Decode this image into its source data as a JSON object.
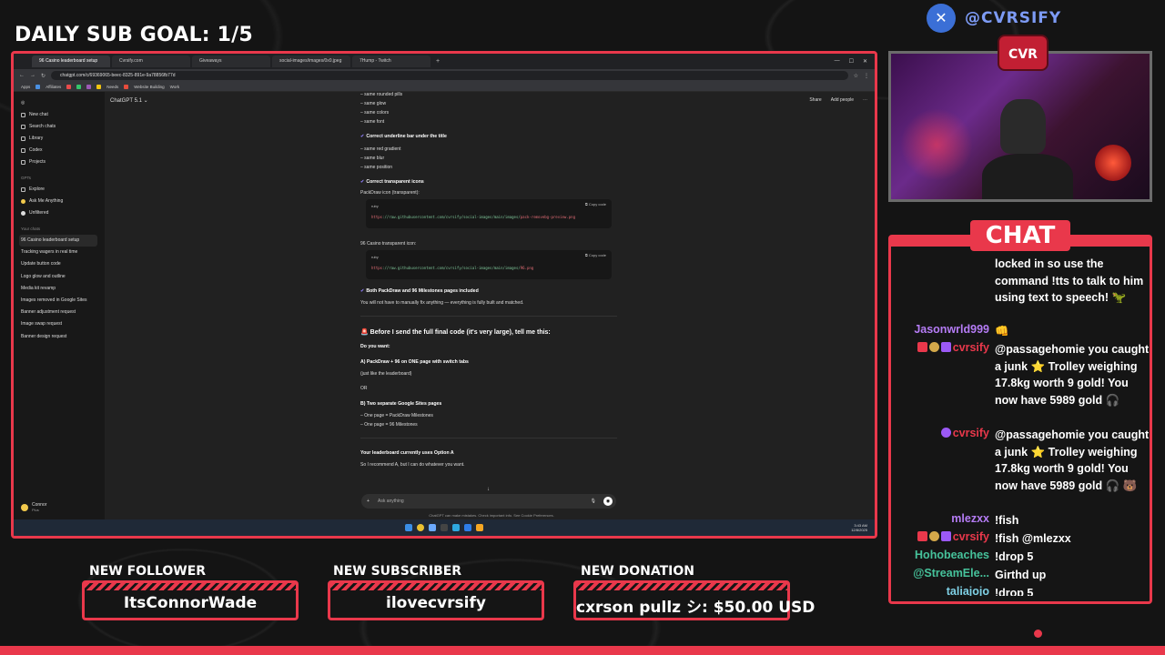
{
  "overlay": {
    "goal_label": "DAILY SUB GOAL: 1/5",
    "handle": "@CVRSIFY",
    "logo_text": "CVR",
    "chat_title": "CHAT",
    "alerts": [
      {
        "label": "NEW FOLLOWER",
        "value": "ItsConnorWade"
      },
      {
        "label": "NEW SUBSCRIBER",
        "value": "ilovecvrsify"
      },
      {
        "label": "NEW DONATION",
        "value": "cxrson pullz シ: $50.00 USD"
      }
    ],
    "accent": "#e9384b"
  },
  "browser": {
    "tabs": [
      "96 Casino leaderboard setup",
      "Cvrsify.com",
      "Giveaways",
      "social-images/images/0x0.jpeg",
      "7Hump - Twitch"
    ],
    "url": "chatgpt.com/c/69369065-beec-8325-891e-9a78856fb77d",
    "bookmarks": [
      "Apps",
      "Affiliates",
      "Needs",
      "Website Building",
      "Work"
    ]
  },
  "chatgpt": {
    "model": "ChatGPT 5.1",
    "share": "Share",
    "add_people": "Add people",
    "sidebar_items": [
      "New chat",
      "Search chats",
      "Library",
      "Codex",
      "Projects"
    ],
    "gpts_header": "GPTs",
    "gpts": [
      "Explore",
      "Ask Me Anything",
      "Unfiltered"
    ],
    "chats_header": "Your chats",
    "chats": [
      "96 Casino leaderboard setup",
      "Tracking wagers in real time",
      "Update button code",
      "Logo glow and outline",
      "Media kit revamp",
      "Images removed in Google Sites",
      "Banner adjustment request",
      "Image swap request",
      "Banner design request"
    ],
    "user_name": "Connor",
    "user_plan": "Plus",
    "lines": {
      "l1": "– same rounded pills",
      "l2": "– same glow",
      "l3": "– same colors",
      "l4": "– same font",
      "h1": "Correct underline bar under the title",
      "l5": "– same red gradient",
      "l6": "– same blur",
      "l7": "– same position",
      "h2": "Correct transparent icons",
      "l8": "PackDraw icon (transparent):",
      "l9": "96 Casino transparent icon:",
      "h3": "Both PackDraw and 96 Milestones pages included",
      "l10": "You will not have to manually fix anything — everything is fully built and matched.",
      "big": "🚨 Before I send the full final code (it's very large), tell me this:",
      "q": "Do you want:",
      "a": "A) PackDraw + 96 on ONE page with switch tabs",
      "a_sub": "(just like the leaderboard)",
      "or": "OR",
      "b": "B) Two separate Google Sites pages",
      "b1": "– One page = PackDraw Milestones",
      "b2": "– One page = 96 Milestones",
      "cur": "Your leaderboard currently uses Option A",
      "rec": "So I recommend A, but I can do whatever you want."
    },
    "code1": {
      "lang": "ruby",
      "copy": "Copy code",
      "prefix": "https",
      "src": "://raw.githubusercontent.com/cvrsify/social-images/main/images/",
      "file": "pack-removebg-preview.png"
    },
    "code2": {
      "lang": "ruby",
      "copy": "Copy code",
      "prefix": "https",
      "src": "://raw.githubusercontent.com/cvrsify/social-images/main/images/",
      "file": "96.png"
    },
    "composer_placeholder": "Ask anything",
    "disclaimer": "ChatGPT can make mistakes. Check important info. See Cookie Preferences.",
    "clock_time": "3:43 AM",
    "clock_date": "12/8/2025"
  },
  "chat_messages": [
    {
      "user": "",
      "color": "#ffffff",
      "text": "locked in so use the command !tts to talk to him using text to speech! 🦖",
      "badges": 0
    },
    {
      "user": "Jasonwrld999",
      "color": "#b57cf5",
      "text": "👊",
      "badges": 0
    },
    {
      "user": "cvrsify",
      "color": "#e9384b",
      "text": "@passagehomie you caught a junk ⭐ Trolley weighing 17.8kg worth 9 gold! You now have 5989 gold 🎧",
      "badges": 3
    },
    {
      "user": "cvrsify",
      "color": "#e9384b",
      "text": "@passagehomie you caught a junk ⭐ Trolley weighing 17.8kg worth 9 gold! You now have 5989 gold 🎧 🐻",
      "badges": 1
    },
    {
      "user": "mlezxx",
      "color": "#b57cf5",
      "text": "!fish",
      "badges": 0
    },
    {
      "user": "cvrsify",
      "color": "#e9384b",
      "text": "!fish @mlezxx",
      "badges": 3
    },
    {
      "user": "Hohobeaches",
      "color": "#46c29b",
      "text": "!drop 5",
      "badges": 0
    },
    {
      "user": "@StreamEle...",
      "color": "#46c29b",
      "text": "Girthd up",
      "badges": 0
    },
    {
      "user": "taliajojo",
      "color": "#7fd1e6",
      "text": "!drop 5",
      "badges": 0
    }
  ]
}
